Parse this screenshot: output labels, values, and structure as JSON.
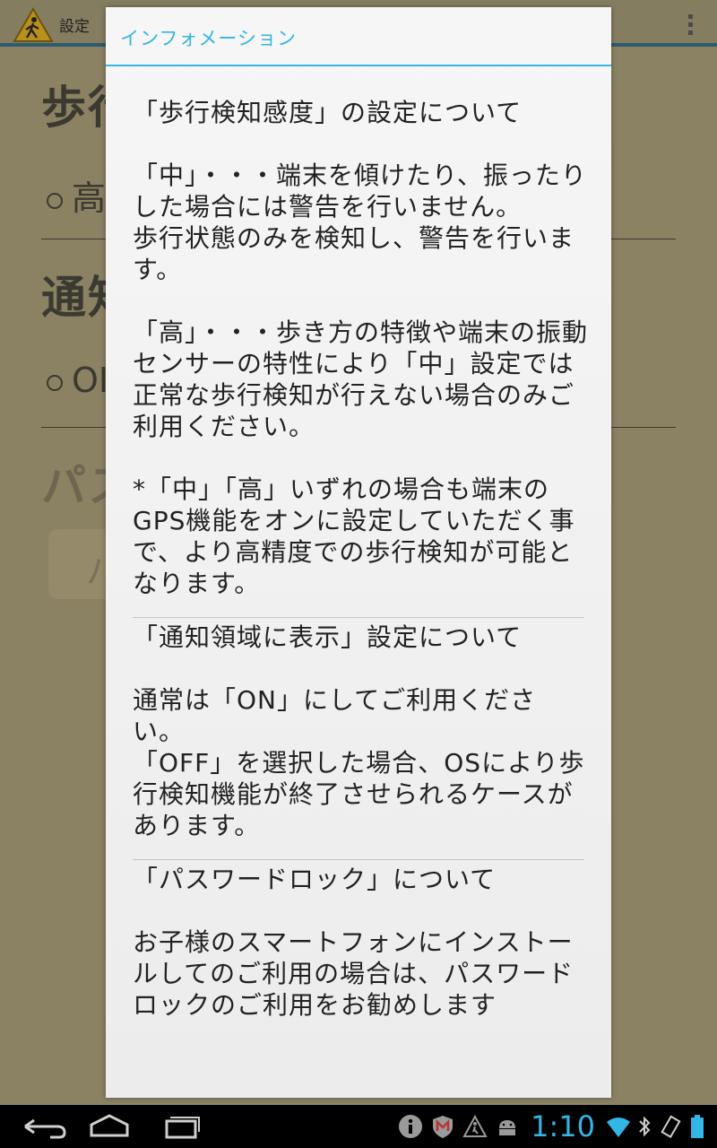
{
  "background": {
    "app_title": "設定",
    "heading_1": "歩行",
    "radio_1": "高",
    "heading_2": "通知",
    "radio_2": "OI",
    "heading_3": "パス",
    "button_fragment": "パ"
  },
  "dialog": {
    "title": "インフォメーション",
    "sections": [
      {
        "title": "「歩行検知感度」の設定について",
        "paragraphs": [
          "「中」・・・端末を傾けたり、振ったりした場合には警告を行いません。",
          "歩行状態のみを検知し、警告を行います。",
          "「高」・・・歩き方の特徴や端末の振動センサーの特性により「中」設定では正常な歩行検知が行えない場合のみご利用ください。",
          "*「中」「高」いずれの場合も端末のGPS機能をオンに設定していただく事で、より高精度での歩行検知が可能となります。"
        ]
      },
      {
        "title": "「通知領域に表示」設定について",
        "paragraphs": [
          "通常は「ON」にしてご利用ください。",
          "「OFF」を選択した場合、OSにより歩行検知機能が終了させられるケースがあります。"
        ]
      },
      {
        "title": "「パスワードロック」について",
        "paragraphs": [
          "お子様のスマートフォンにインストールしてのご利用の場合は、パスワードロックのご利用をお勧めします"
        ]
      }
    ]
  },
  "status_bar": {
    "time": "1:10",
    "colors": {
      "accent": "#33b5e5",
      "nav_bg": "#000000"
    }
  }
}
